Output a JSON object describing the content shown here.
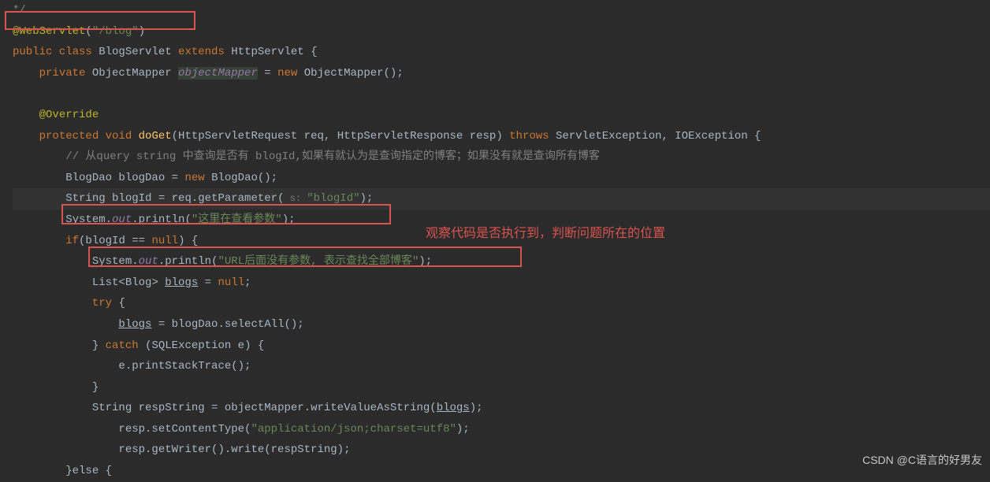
{
  "code": {
    "l0": "*/",
    "l1_ann": "@WebServlet",
    "l1_paren_open": "(",
    "l1_str": "\"/blog\"",
    "l1_paren_close": ")",
    "l2_kw1": "public class ",
    "l2_cls": "BlogServlet ",
    "l2_kw2": "extends ",
    "l2_sup": "HttpServlet {",
    "l3_kw": "private ",
    "l3_type": "ObjectMapper ",
    "l3_field": "objectMapper",
    "l3_eq": " = ",
    "l3_new": "new ",
    "l3_ctor": "ObjectMapper();",
    "l4_ann": "@Override",
    "l5_kw1": "protected void ",
    "l5_method": "doGet",
    "l5_params": "(HttpServletRequest req, HttpServletResponse resp) ",
    "l5_kw2": "throws ",
    "l5_exc": "ServletException, IOException {",
    "l6_comment": "// 从query string 中查询是否有 blogId,如果有就认为是查询指定的博客；如果没有就是查询所有博客",
    "l7_type": "BlogDao blogDao = ",
    "l7_new": "new ",
    "l7_ctor": "BlogDao();",
    "l8_txt": "String blogId = req.getParameter(",
    "l8_hint": " s: ",
    "l8_str": "\"blogId\"",
    "l8_end": ");",
    "l9_a": "System.",
    "l9_out": "out",
    "l9_b": ".println(",
    "l9_str": "\"这里在查看参数\"",
    "l9_end": ");",
    "l10_kw": "if",
    "l10_cond": "(blogId == ",
    "l10_null": "null",
    "l10_end": ") {",
    "l11_a": "System.",
    "l11_out": "out",
    "l11_b": ".println(",
    "l11_str": "\"URL后面没有参数, 表示查找全部博客\"",
    "l11_end": ");",
    "l12_a": "List<Blog> ",
    "l12_var": "blogs",
    "l12_b": " = ",
    "l12_null": "null",
    "l12_end": ";",
    "l13_try": "try ",
    "l13_brace": "{",
    "l14_var": "blogs",
    "l14_rest": " = blogDao.selectAll();",
    "l15_brace": "} ",
    "l15_catch": "catch ",
    "l15_params": "(SQLException e) {",
    "l16": "e.printStackTrace();",
    "l17": "}",
    "l18_a": "String respString = objectMapper.writeValueAsString(",
    "l18_var": "blogs",
    "l18_end": ");",
    "l19_a": "resp.setContentType(",
    "l19_str": "\"application/json;charset=utf8\"",
    "l19_end": ");",
    "l20": "resp.getWriter().write(respString);",
    "l21_else": "}else {"
  },
  "annotation_text": "观察代码是否执行到，判断问题所在的位置",
  "watermark": "CSDN @C语言的好男友"
}
